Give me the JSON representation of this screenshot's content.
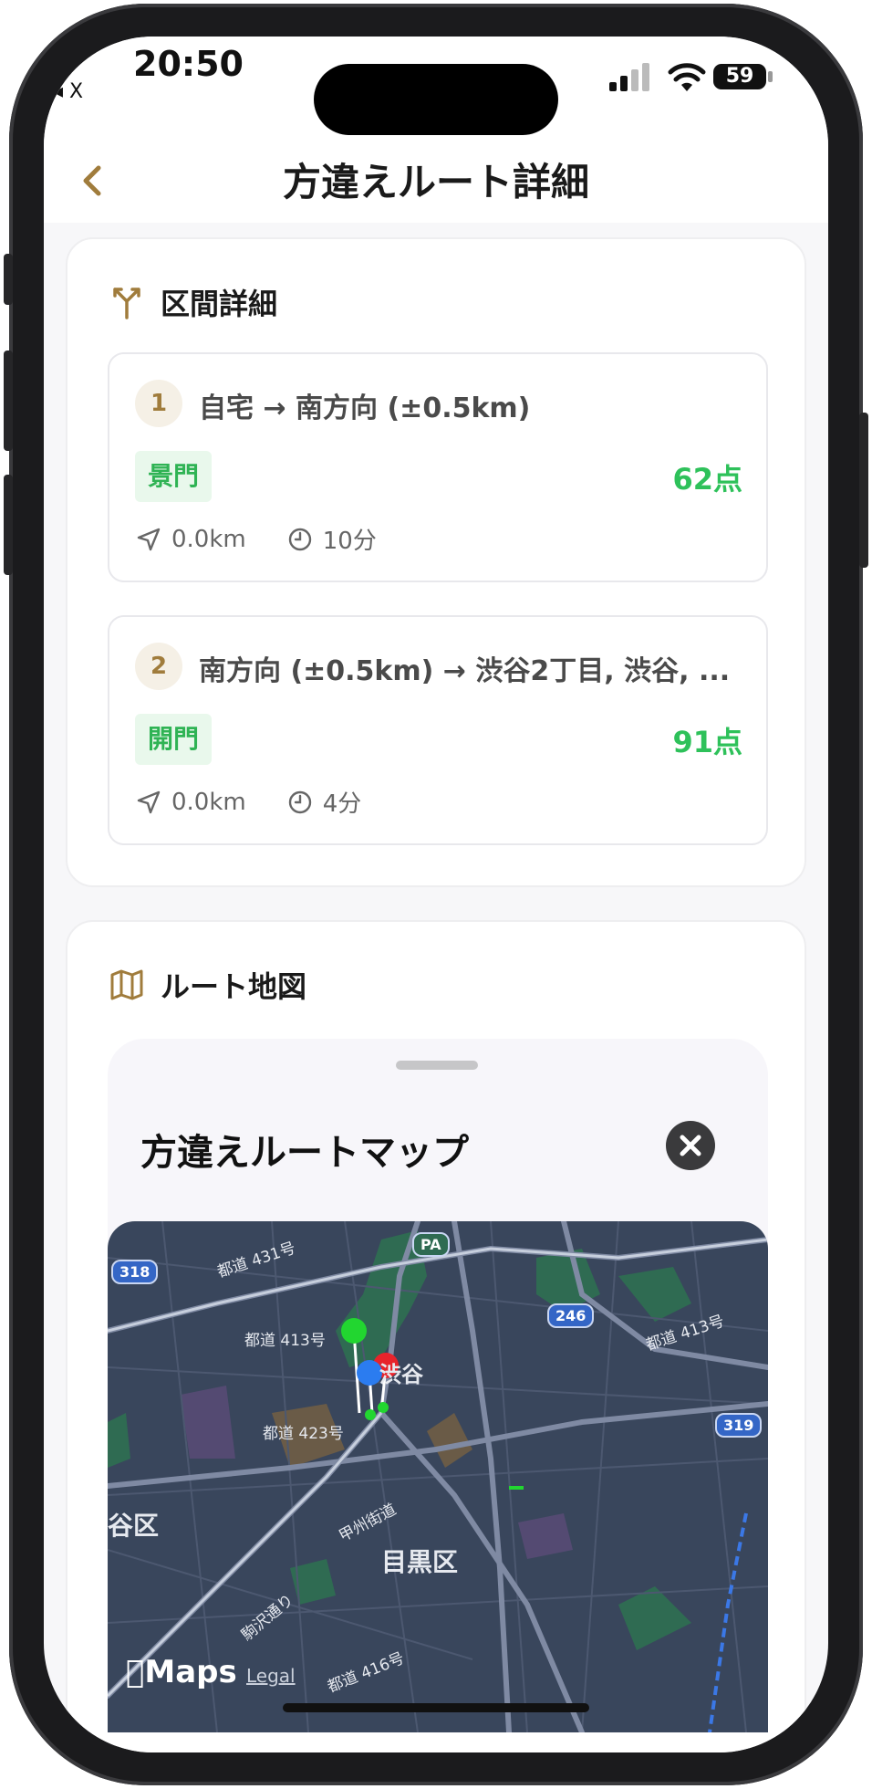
{
  "status_bar": {
    "time": "20:50",
    "back_app": "◂ X",
    "battery": "59"
  },
  "nav": {
    "back_icon": "chevron-left-icon",
    "title": "方違えルート詳細"
  },
  "segments_card": {
    "title": "区間詳細",
    "icon": "route-split-icon",
    "segments": [
      {
        "number": "1",
        "route": "自宅 → 南方向 (±0.5km)",
        "gate": "景門",
        "score": "62点",
        "distance": "0.0km",
        "duration": "10分"
      },
      {
        "number": "2",
        "route": "南方向 (±0.5km) → 渋谷2丁目, 渋谷, ...",
        "gate": "開門",
        "score": "91点",
        "distance": "0.0km",
        "duration": "4分"
      }
    ]
  },
  "map_card": {
    "title": "ルート地図",
    "icon": "map-icon",
    "sheet_title": "方違えルートマップ",
    "close_icon": "close-icon",
    "map": {
      "labels": [
        "都道 431号",
        "都道 413号",
        "都道 423号",
        "都道 413号",
        "甲州街道",
        "駒沢通り",
        "都道 416号",
        "渋谷"
      ],
      "wards": [
        "目黒区",
        "谷区"
      ],
      "shields": [
        "318",
        "246",
        "319",
        "PA"
      ],
      "attribution": "Maps",
      "legal": "Legal",
      "pin_colors": [
        "#22d630",
        "#2b7cf0",
        "#e8232b"
      ]
    }
  }
}
